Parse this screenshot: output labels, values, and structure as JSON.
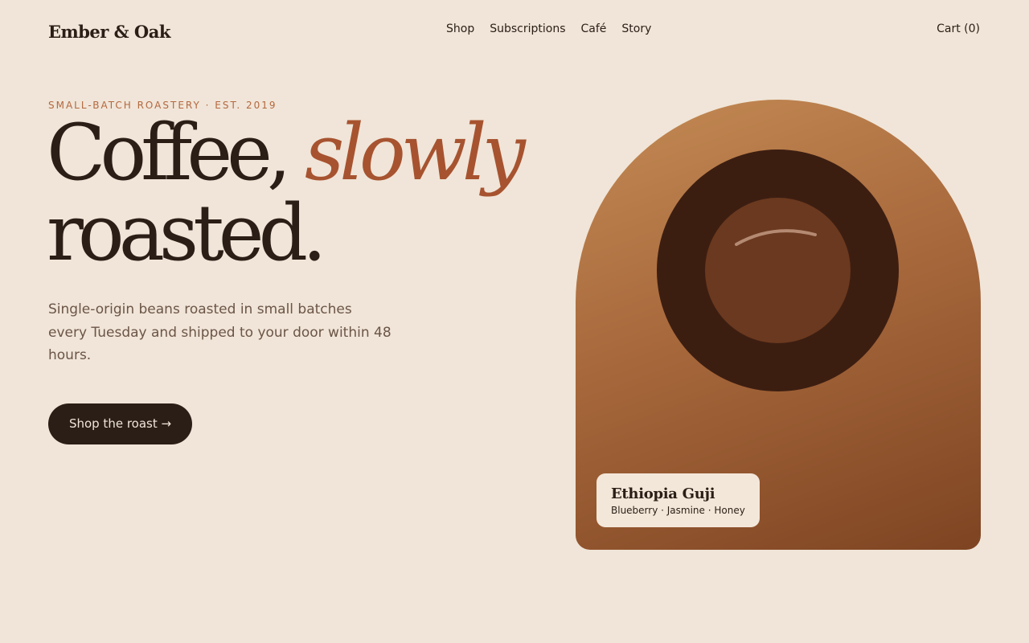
{
  "header": {
    "logo": "Ember & Oak",
    "nav": [
      "Shop",
      "Subscriptions",
      "Café",
      "Story"
    ],
    "cart": "Cart (0)"
  },
  "hero": {
    "eyebrow": "SMALL-BATCH ROASTERY · EST. 2019",
    "headline_part1": "Coffee, ",
    "headline_em": "slowly",
    "headline_part2": "roasted.",
    "lede": "Single-origin beans roasted in small batches every Tuesday and shipped to your door within 48 hours.",
    "cta": "Shop the roast →"
  },
  "feature": {
    "name": "Ethiopia Guji",
    "notes": "Blueberry · Jasmine · Honey"
  },
  "colors": {
    "background": "#f0e5d8",
    "accent": "#a75330",
    "dark": "#2a1e16",
    "arch_top": "#c48b55",
    "arch_bottom": "#7e4422"
  }
}
